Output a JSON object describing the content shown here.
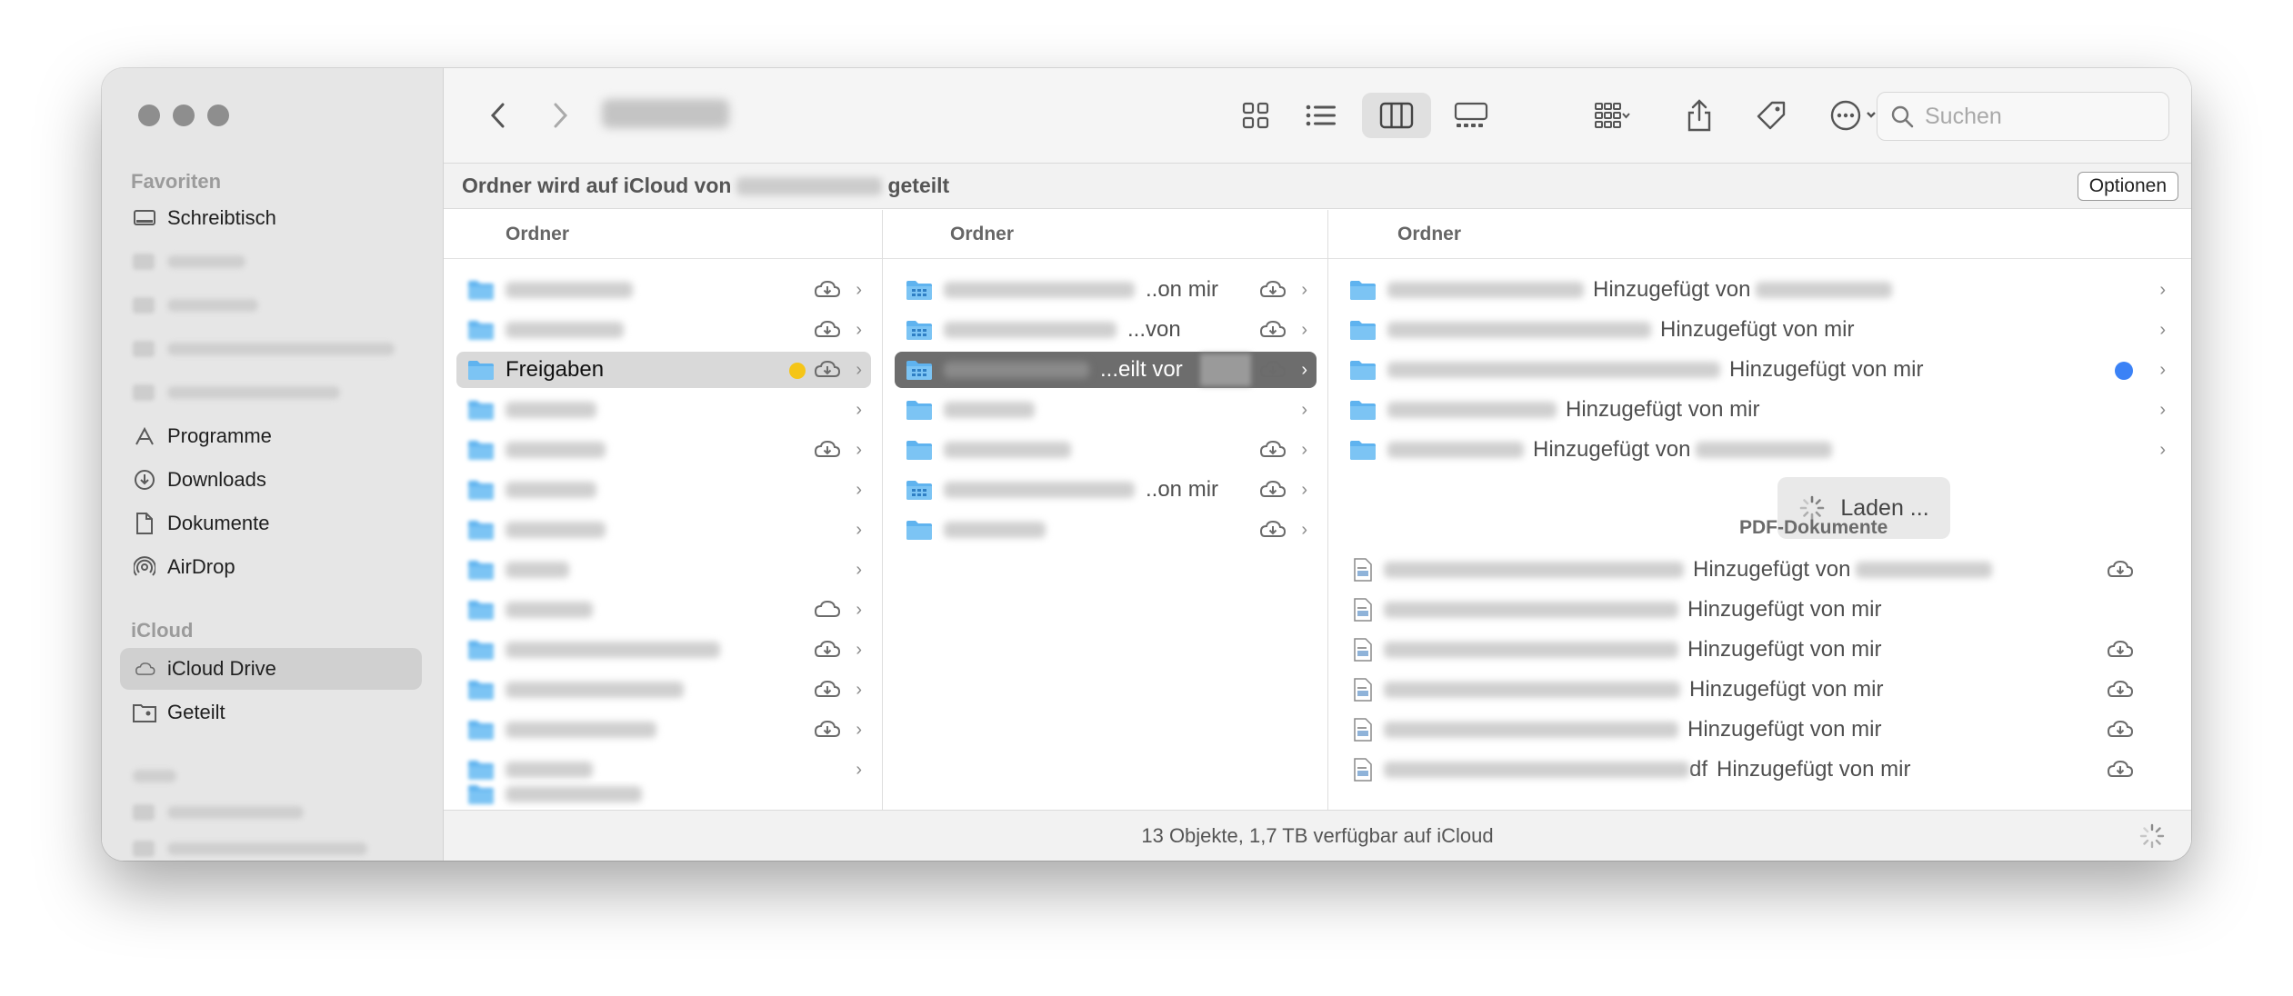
{
  "window": {
    "breadcrumb_title_blurred": true
  },
  "sidebar": {
    "favorites_label": "Favoriten",
    "favorites": [
      {
        "label": "Schreibtisch",
        "icon": "desktop-icon"
      },
      {
        "label": "Programme",
        "icon": "apps-icon"
      },
      {
        "label": "Downloads",
        "icon": "download-icon"
      },
      {
        "label": "Dokumente",
        "icon": "document-icon"
      },
      {
        "label": "AirDrop",
        "icon": "airdrop-icon"
      }
    ],
    "icloud_label": "iCloud",
    "icloud": [
      {
        "label": "iCloud Drive",
        "icon": "cloud-icon",
        "active": true
      },
      {
        "label": "Geteilt",
        "icon": "shared-folder-icon"
      }
    ]
  },
  "toolbar": {
    "search_placeholder": "Suchen"
  },
  "banner": {
    "prefix": "Ordner wird auf iCloud von",
    "suffix": "geteilt",
    "options_label": "Optionen"
  },
  "columns": {
    "header": "Ordner",
    "col1": {
      "selected_label": "Freigaben"
    },
    "col2": {
      "visible_fragments": [
        "..on mir",
        "...von",
        "...eilt vor"
      ]
    },
    "col3": {
      "folders": [
        {
          "suffix": "Hinzugefügt von"
        },
        {
          "suffix": "Hinzugefügt von mir"
        },
        {
          "suffix": "Hinzugefügt von mir",
          "tag_color": "#3b82f6"
        },
        {
          "suffix": "Hinzugefügt von mir"
        },
        {
          "suffix": "Hinzugefügt von"
        }
      ],
      "loading_label": "Laden ...",
      "pdf_section_label": "PDF-Dokumente",
      "pdfs": [
        {
          "suffix": "Hinzugefügt von"
        },
        {
          "suffix": "Hinzugefügt von mir"
        },
        {
          "suffix": "Hinzugefügt von mir"
        },
        {
          "suffix": "Hinzugefügt von mir"
        },
        {
          "suffix": "Hinzugefügt von mir"
        },
        {
          "visible": "df",
          "suffix": "Hinzugefügt von mir"
        }
      ]
    }
  },
  "status": {
    "text": "13 Objekte, 1,7 TB verfügbar auf iCloud"
  },
  "colors": {
    "folder_blue": "#5fb3ef",
    "tag_yellow": "#f5c518",
    "tag_blue": "#3b82f6",
    "selection_dark": "#6d6d6d"
  }
}
